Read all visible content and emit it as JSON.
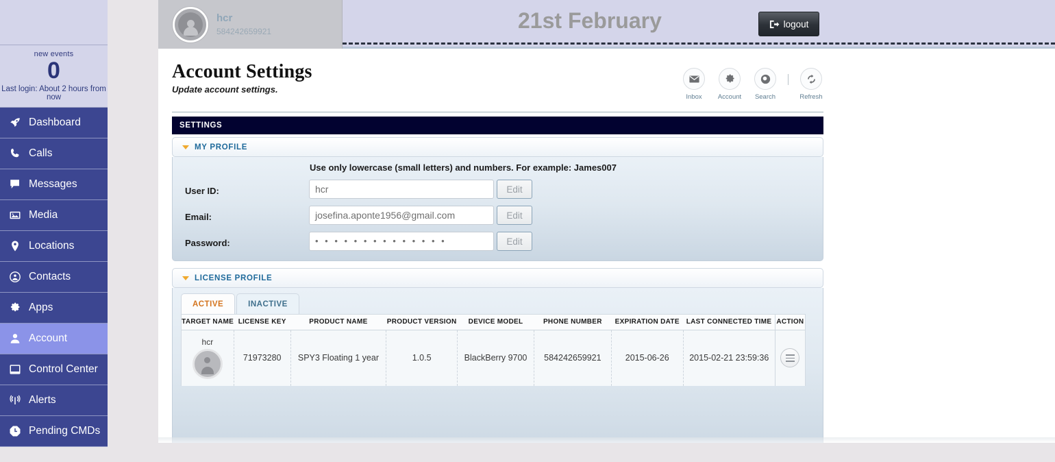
{
  "sidebar": {
    "events": {
      "label": "new events",
      "count": "0",
      "last_login": "Last login: About 2 hours from now"
    },
    "items": [
      {
        "label": "Dashboard",
        "icon": "rocket-icon",
        "active": false
      },
      {
        "label": "Calls",
        "icon": "phone-icon",
        "active": false
      },
      {
        "label": "Messages",
        "icon": "chat-bubble-icon",
        "active": false
      },
      {
        "label": "Media",
        "icon": "image-icon",
        "active": false
      },
      {
        "label": "Locations",
        "icon": "map-pin-icon",
        "active": false
      },
      {
        "label": "Contacts",
        "icon": "contact-circle-icon",
        "active": false
      },
      {
        "label": "Apps",
        "icon": "gear-icon",
        "active": false
      },
      {
        "label": "Account",
        "icon": "person-icon",
        "active": true
      },
      {
        "label": "Control Center",
        "icon": "window-icon",
        "active": false
      },
      {
        "label": "Alerts",
        "icon": "signal-tower-icon",
        "active": false
      },
      {
        "label": "Pending CMDs",
        "icon": "clock-octagon-icon",
        "active": false
      }
    ],
    "accent_active": "#8b93e8",
    "accent_nav": "#3c4691"
  },
  "header": {
    "user_name": "hcr",
    "user_phone": "584242659921",
    "date": "21st February",
    "logout_label": "logout",
    "logout_icon": "logout-arrow-icon"
  },
  "page": {
    "title": "Account Settings",
    "subtitle": "Update account settings."
  },
  "toolbar": {
    "items": [
      {
        "label": "Inbox",
        "icon": "envelope-icon"
      },
      {
        "label": "Account",
        "icon": "gear-icon"
      },
      {
        "label": "Search",
        "icon": "search-icon"
      },
      {
        "label": "Refresh",
        "icon": "refresh-icon"
      }
    ]
  },
  "settings_bar": {
    "title": "SETTINGS"
  },
  "my_profile": {
    "section_title": "MY PROFILE",
    "hint": "Use only lowercase (small letters) and numbers. For example: James007",
    "fields": [
      {
        "label": "User ID:",
        "value": "hcr",
        "edit_label": "Edit"
      },
      {
        "label": "Email:",
        "value": "josefina.aponte1956@gmail.com",
        "edit_label": "Edit"
      },
      {
        "label": "Password:",
        "value": "• • • • • • • • • • • • • •",
        "edit_label": "Edit"
      }
    ]
  },
  "license_profile": {
    "section_title": "LICENSE PROFILE",
    "tabs": [
      {
        "label": "ACTIVE",
        "selected": true
      },
      {
        "label": "INACTIVE",
        "selected": false
      }
    ],
    "columns": [
      "TARGET NAME",
      "LICENSE KEY",
      "PRODUCT NAME",
      "PRODUCT VERSION",
      "DEVICE MODEL",
      "PHONE NUMBER",
      "EXPIRATION DATE",
      "LAST CONNECTED TIME",
      "ACTION"
    ],
    "rows": [
      {
        "target_name": "hcr",
        "license_key": "71973280",
        "product_name": "SPY3 Floating 1 year",
        "product_version": "1.0.5",
        "device_model": "BlackBerry 9700",
        "phone_number": "584242659921",
        "expiration_date": "2015-06-26",
        "last_connected_time": "2015-02-21 23:59:36",
        "action_icon": "menu-lines-icon"
      }
    ]
  },
  "colors": {
    "settings_bar_bg": "#020230",
    "section_title": "#1f6a9b",
    "tab_selected_text": "#d4751f",
    "caret": "#f0a92e"
  }
}
